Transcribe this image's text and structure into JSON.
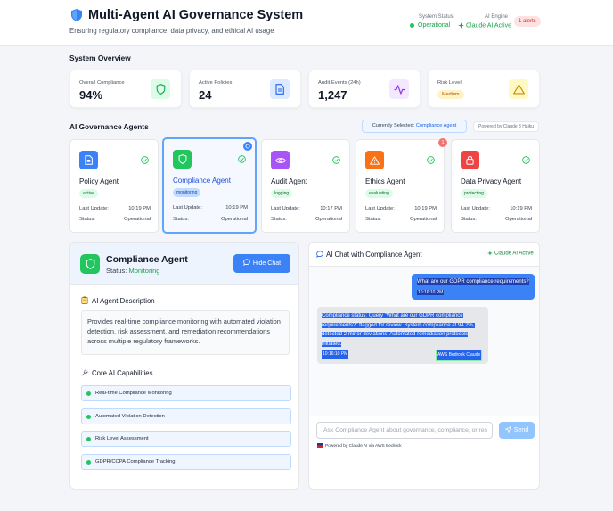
{
  "header": {
    "title": "Multi-Agent AI Governance System",
    "subtitle": "Ensuring regulatory compliance, data privacy, and ethical AI usage",
    "system_status_label": "System Status",
    "system_status_value": "Operational",
    "ai_engine_label": "AI Engine",
    "ai_engine_value": "Claude AI Active",
    "alerts": "1 alerts"
  },
  "overview": {
    "title": "System Overview",
    "cards": [
      {
        "label": "Overall Compliance",
        "value": "94%",
        "icon": "shield-icon",
        "color": "#22c55e"
      },
      {
        "label": "Active Policies",
        "value": "24",
        "icon": "document-icon",
        "color": "#3b82f6"
      },
      {
        "label": "Audit Events (24h)",
        "value": "1,247",
        "icon": "activity-icon",
        "color": "#a855f7"
      },
      {
        "label": "Risk Level",
        "value": "Medium",
        "icon": "warning-icon",
        "color": "#eab308"
      }
    ]
  },
  "agents_section": {
    "title": "AI Governance Agents",
    "currently_selected_prefix": "Currently Selected:",
    "currently_selected_value": "Compliance Agent",
    "powered_by": "Powered by Claude 3 Haiku",
    "last_update_label": "Last Update:",
    "status_label": "Status:",
    "agents": [
      {
        "name": "Policy Agent",
        "badge": "active",
        "last_update": "10:19 PM",
        "status": "Operational",
        "icon": "document-icon",
        "color": "#3b82f6"
      },
      {
        "name": "Compliance Agent",
        "badge": "monitoring",
        "last_update": "10:19 PM",
        "status": "Operational",
        "icon": "shield-icon",
        "color": "#22c55e"
      },
      {
        "name": "Audit Agent",
        "badge": "logging",
        "last_update": "10:17 PM",
        "status": "Operational",
        "icon": "eye-icon",
        "color": "#a855f7"
      },
      {
        "name": "Ethics Agent",
        "badge": "evaluating",
        "last_update": "10:19 PM",
        "status": "Operational",
        "icon": "warning-icon",
        "color": "#f97316",
        "alert_count": "1"
      },
      {
        "name": "Data Privacy Agent",
        "badge": "protecting",
        "last_update": "10:19 PM",
        "status": "Operational",
        "icon": "lock-icon",
        "color": "#ef4444"
      }
    ]
  },
  "detail": {
    "title": "Compliance Agent",
    "status_prefix": "Status:",
    "status_value": "Monitoring",
    "hide_chat_label": "Hide Chat",
    "description_title": "AI Agent Description",
    "description": "Provides real-time compliance monitoring with automated violation detection, risk assessment, and remediation recommendations across multiple regulatory frameworks.",
    "capabilities_title": "Core AI Capabilities",
    "capabilities": [
      "Real-time Compliance Monitoring",
      "Automated Violation Detection",
      "Risk Level Assessment",
      "GDPR/CCPA Compliance Tracking"
    ]
  },
  "chat": {
    "title": "AI Chat with Compliance Agent",
    "status": "Claude AI Active",
    "messages": [
      {
        "role": "user",
        "text": "What are our GDPR compliance requirements?",
        "time": "10:16:10 PM"
      },
      {
        "role": "ai",
        "text": "Compliance status: Query \"What are our GDPR compliance requirements?\" flagged for review. System compliance at 94.2%, detected 2 minor deviations. Automated remediation protocols initiated.",
        "time": "10:16:10 PM",
        "tag": "AWS Bedrock Claude"
      }
    ],
    "input_placeholder": "Ask Compliance Agent about governance, compliance, or res",
    "send_label": "Send",
    "footer": "Powered by Claude AI via AWS Bedrock"
  }
}
